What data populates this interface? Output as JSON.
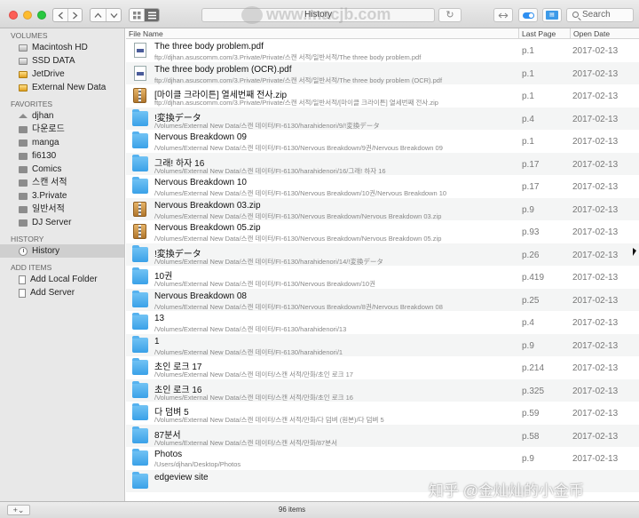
{
  "toolbar": {
    "title": "History",
    "search_placeholder": "Search",
    "view_modes": [
      "grid-icon",
      "list-icon"
    ],
    "nav_icons": [
      "chevron-left-icon",
      "chevron-right-icon",
      "chevron-up-icon",
      "chevron-down-icon"
    ],
    "traffic_lights": {
      "close": "#fc5f57",
      "minimize": "#fdbc2e",
      "zoom": "#28c840"
    }
  },
  "sidebar": {
    "volumes_header": "VOLUMES",
    "volumes": [
      {
        "label": "Macintosh HD",
        "icon": "drive-icon"
      },
      {
        "label": "SSD DATA",
        "icon": "drive-icon"
      },
      {
        "label": "JetDrive",
        "icon": "external-drive-icon"
      },
      {
        "label": "External New Data",
        "icon": "external-drive-icon"
      }
    ],
    "favorites_header": "FAVORITES",
    "favorites": [
      {
        "label": "djhan",
        "icon": "home-icon"
      },
      {
        "label": "다운로드",
        "icon": "folder-icon"
      },
      {
        "label": "manga",
        "icon": "folder-icon"
      },
      {
        "label": "fi6130",
        "icon": "folder-icon"
      },
      {
        "label": "Comics",
        "icon": "folder-icon"
      },
      {
        "label": "스캔 서적",
        "icon": "folder-icon"
      },
      {
        "label": "3.Private",
        "icon": "folder-icon"
      },
      {
        "label": "일반서적",
        "icon": "folder-icon"
      },
      {
        "label": "DJ Server",
        "icon": "folder-icon"
      }
    ],
    "history_header": "HISTORY",
    "history": [
      {
        "label": "History",
        "icon": "clock-icon",
        "selected": true
      }
    ],
    "add_items_header": "ADD ITEMS",
    "add_items": [
      {
        "label": "Add Local Folder",
        "icon": "document-icon"
      },
      {
        "label": "Add Server",
        "icon": "document-icon"
      }
    ]
  },
  "list": {
    "columns": {
      "name": "File Name",
      "last_page": "Last Page",
      "open_date": "Open Date"
    },
    "rows": [
      {
        "type": "pdf",
        "name": "The three body problem.pdf",
        "path": "ftp://djhan.asuscomm.com/3.Private/Private/스캔 서적/일반서적/The three body problem.pdf",
        "page": "p.1",
        "date": "2017-02-13"
      },
      {
        "type": "pdf",
        "name": "The three body problem (OCR).pdf",
        "path": "ftp://djhan.asuscomm.com/3.Private/Private/스캔 서적/일반서적/The three body problem (OCR).pdf",
        "page": "p.1",
        "date": "2017-02-13"
      },
      {
        "type": "zip",
        "name": "[마이클 크라이튼] 열세번째 전사.zip",
        "path": "ftp://djhan.asuscomm.com/3.Private/Private/스캔 서적/일반서적/[마이클 크라이튼] 열세번째 전사.zip",
        "page": "p.1",
        "date": "2017-02-13"
      },
      {
        "type": "folder",
        "name": "!変換データ",
        "path": "/Volumes/External New Data/스캔 데이터/FI-6130/harahidenori/9/!変換データ",
        "page": "p.4",
        "date": "2017-02-13"
      },
      {
        "type": "folder",
        "name": "Nervous Breakdown 09",
        "path": "/Volumes/External New Data/스캔 데이터/FI-6130/Nervous Breakdown/9권/Nervous Breakdown 09",
        "page": "p.1",
        "date": "2017-02-13"
      },
      {
        "type": "folder",
        "name": "그래! 하자 16",
        "path": "/Volumes/External New Data/스캔 데이터/FI-6130/harahidenori/16/그래! 하자 16",
        "page": "p.17",
        "date": "2017-02-13"
      },
      {
        "type": "folder",
        "name": "Nervous Breakdown 10",
        "path": "/Volumes/External New Data/스캔 데이터/FI-6130/Nervous Breakdown/10권/Nervous Breakdown 10",
        "page": "p.17",
        "date": "2017-02-13"
      },
      {
        "type": "zip",
        "name": "Nervous Breakdown 03.zip",
        "path": "/Volumes/External New Data/스캔 데이터/FI-6130/Nervous Breakdown/Nervous Breakdown 03.zip",
        "page": "p.9",
        "date": "2017-02-13"
      },
      {
        "type": "zip",
        "name": "Nervous Breakdown 05.zip",
        "path": "/Volumes/External New Data/스캔 데이터/FI-6130/Nervous Breakdown/Nervous Breakdown 05.zip",
        "page": "p.93",
        "date": "2017-02-13"
      },
      {
        "type": "folder",
        "name": "!変換データ",
        "path": "/Volumes/External New Data/스캔 데이터/FI-6130/harahidenori/14/!変換データ",
        "page": "p.26",
        "date": "2017-02-13"
      },
      {
        "type": "folder",
        "name": "10권",
        "path": "/Volumes/External New Data/스캔 데이터/FI-6130/Nervous Breakdown/10권",
        "page": "p.419",
        "date": "2017-02-13"
      },
      {
        "type": "folder",
        "name": "Nervous Breakdown 08",
        "path": "/Volumes/External New Data/스캔 데이터/FI-6130/Nervous Breakdown/8권/Nervous Breakdown 08",
        "page": "p.25",
        "date": "2017-02-13"
      },
      {
        "type": "folder",
        "name": "13",
        "path": "/Volumes/External New Data/스캔 데이터/FI-6130/harahidenori/13",
        "page": "p.4",
        "date": "2017-02-13"
      },
      {
        "type": "folder",
        "name": "1",
        "path": "/Volumes/External New Data/스캔 데이터/FI-6130/harahidenori/1",
        "page": "p.9",
        "date": "2017-02-13"
      },
      {
        "type": "folder",
        "name": "초인 로크 17",
        "path": "/Volumes/External New Data/스캔 데이터/스캔 서적/만화/초인 로크 17",
        "page": "p.214",
        "date": "2017-02-13"
      },
      {
        "type": "folder",
        "name": "초인 로크 16",
        "path": "/Volumes/External New Data/스캔 데이터/스캔 서적/만화/초인 로크 16",
        "page": "p.325",
        "date": "2017-02-13"
      },
      {
        "type": "folder",
        "name": "다 덤벼 5",
        "path": "/Volumes/External New Data/스캔 데이터/스캔 서적/만화/다 덤벼 (원본)/다 덤벼 5",
        "page": "p.59",
        "date": "2017-02-13"
      },
      {
        "type": "folder",
        "name": "87분서",
        "path": "/Volumes/External New Data/스캔 데이터/스캔 서적/만화/87분서",
        "page": "p.58",
        "date": "2017-02-13"
      },
      {
        "type": "folder",
        "name": "Photos",
        "path": "/Users/djhan/Desktop/Photos",
        "page": "p.9",
        "date": "2017-02-13"
      },
      {
        "type": "folder",
        "name": "edgeview site",
        "path": "",
        "page": "",
        "date": ""
      }
    ]
  },
  "bottombar": {
    "add_label": "+⌄",
    "item_count": "96 items"
  },
  "watermarks": {
    "top": "www.macjb.com",
    "bottom": "知乎 @金灿灿的小金币"
  },
  "colors": {
    "folder": "#3aa1e8",
    "accent": "#2d8ef0",
    "selection": "#cfcfcf"
  }
}
